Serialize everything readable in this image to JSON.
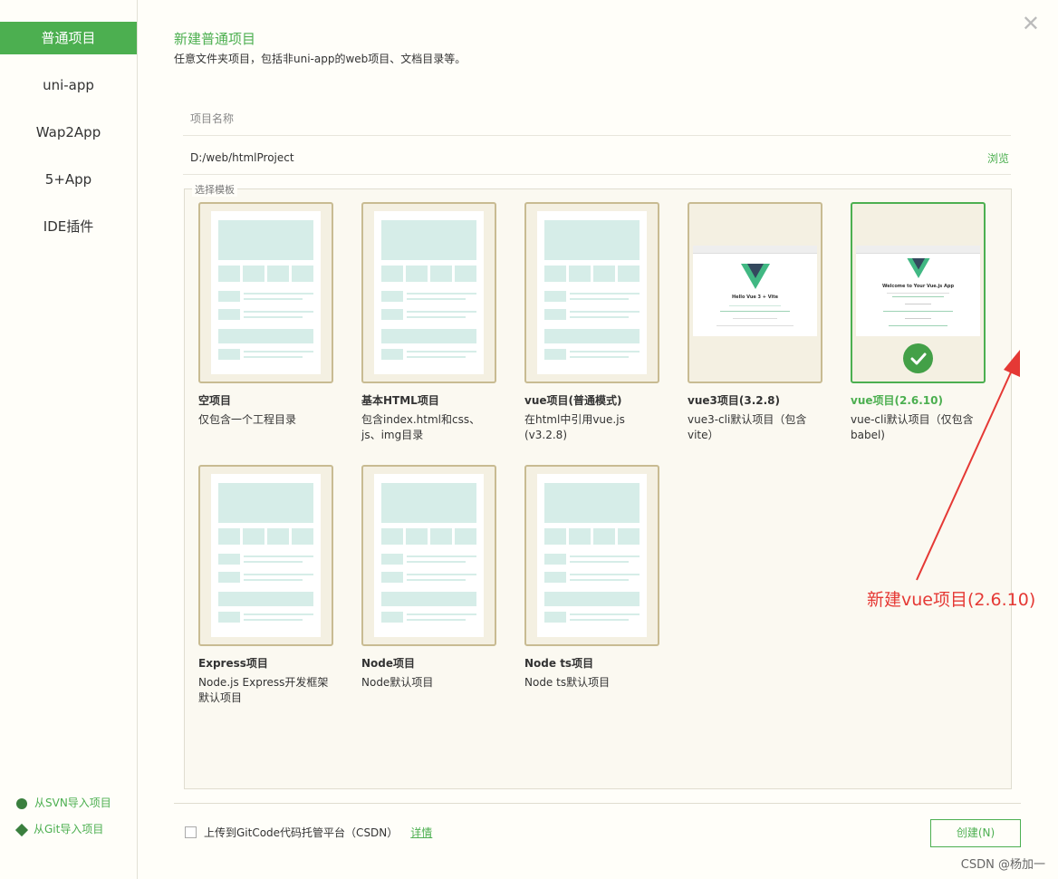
{
  "sidebar": {
    "items": [
      {
        "label": "普通项目"
      },
      {
        "label": "uni-app"
      },
      {
        "label": "Wap2App"
      },
      {
        "label": "5+App"
      },
      {
        "label": "IDE插件"
      }
    ],
    "import_svn": "从SVN导入项目",
    "import_git": "从Git导入项目"
  },
  "header": {
    "title": "新建普通项目",
    "subtitle": "任意文件夹项目，包括非uni-app的web项目、文档目录等。"
  },
  "form": {
    "name_placeholder": "项目名称",
    "path": "D:/web/htmlProject",
    "browse": "浏览",
    "template_legend": "选择模板"
  },
  "templates": [
    {
      "name": "空项目",
      "desc": "仅包含一个工程目录"
    },
    {
      "name": "基本HTML项目",
      "desc": "包含index.html和css、js、img目录"
    },
    {
      "name": "vue项目(普通模式)",
      "desc": "在html中引用vue.js (v3.2.8)"
    },
    {
      "name": "vue3项目(3.2.8)",
      "desc": "vue3-cli默认项目（包含vite）",
      "shot_title": "Hello Vue 3 + Vite"
    },
    {
      "name": "vue项目(2.6.10)",
      "desc": "vue-cli默认项目（仅包含babel)",
      "shot_title": "Welcome to Your Vue.js App",
      "selected": true
    },
    {
      "name": "Express项目",
      "desc": "Node.js Express开发框架默认项目"
    },
    {
      "name": "Node项目",
      "desc": "Node默认项目"
    },
    {
      "name": "Node ts项目",
      "desc": "Node ts默认项目"
    }
  ],
  "annotation": "新建vue项目(2.6.10)",
  "footer": {
    "upload_label": "上传到GitCode代码托管平台（CSDN）",
    "details": "详情",
    "create_button": "创建(N)"
  },
  "watermark": "CSDN @杨加一",
  "colors": {
    "accent": "#4caf50",
    "annotation": "#e53935",
    "card_border": "#c8bb92"
  }
}
